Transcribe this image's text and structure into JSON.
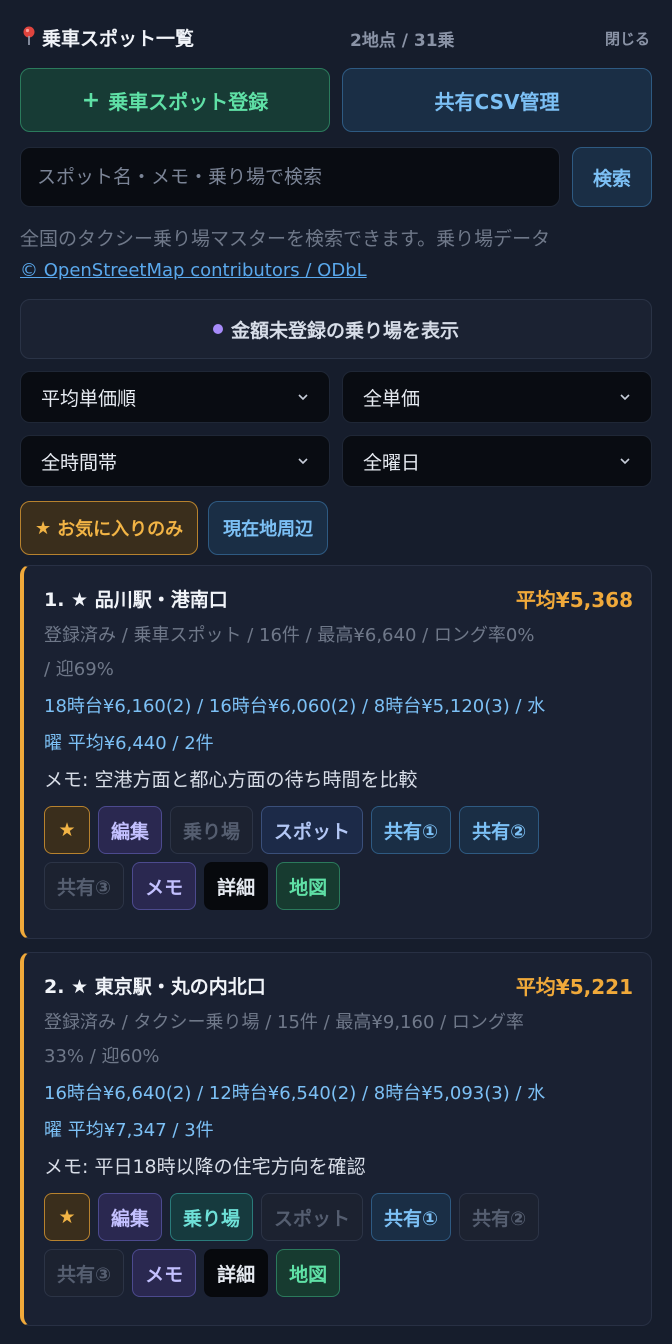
{
  "header": {
    "title": "乗車スポット一覧",
    "count": "2地点 / 31乗",
    "close_label": "閉じる"
  },
  "actions": {
    "register_label": "乗車スポット登録",
    "csv_label": "共有CSV管理"
  },
  "search": {
    "placeholder": "スポット名・メモ・乗り場で検索",
    "button_label": "検索"
  },
  "info": {
    "text": "全国のタクシー乗り場マスターを検索できます。乗り場データ",
    "osm_link": "© OpenStreetMap contributors / ODbL"
  },
  "unregistered_button": "金額未登録の乗り場を表示",
  "selects": {
    "sort": "平均単価順",
    "price": "全単価",
    "time": "全時間帯",
    "weekday": "全曜日"
  },
  "filters": {
    "favorites_label": "お気に入りのみ",
    "nearby_label": "現在地周辺"
  },
  "spots": [
    {
      "title": "1. ★ 品川駅・港南口",
      "avg": "平均¥5,368",
      "meta_line1": "登録済み / 乗車スポット / 16件 / 最高¥6,640 / ロング率0%",
      "meta_line2": "/ 迎69%",
      "times_line1": "18時台¥6,160(2) / 16時台¥6,060(2) / 8時台¥5,120(3) / 水",
      "times_line2": "曜 平均¥6,440 / 2件",
      "memo": "メモ: 空港方面と都心方面の待ち時間を比較",
      "tags": {
        "star": "★",
        "edit": "編集",
        "stand": "乗り場",
        "spot": "スポット",
        "share1": "共有①",
        "share2": "共有②",
        "share3": "共有③",
        "memo": "メモ",
        "detail": "詳細",
        "map": "地図"
      }
    },
    {
      "title": "2. ★ 東京駅・丸の内北口",
      "avg": "平均¥5,221",
      "meta_line1": "登録済み / タクシー乗り場 / 15件 / 最高¥9,160 / ロング率",
      "meta_line2": "33% / 迎60%",
      "times_line1": "16時台¥6,640(2) / 12時台¥6,540(2) / 8時台¥5,093(3) / 水",
      "times_line2": "曜 平均¥7,347 / 3件",
      "memo": "メモ: 平日18時以降の住宅方向を確認",
      "tags": {
        "star": "★",
        "edit": "編集",
        "stand": "乗り場",
        "spot": "スポット",
        "share1": "共有①",
        "share2": "共有②",
        "share3": "共有③",
        "memo": "メモ",
        "detail": "詳細",
        "map": "地図"
      }
    }
  ]
}
